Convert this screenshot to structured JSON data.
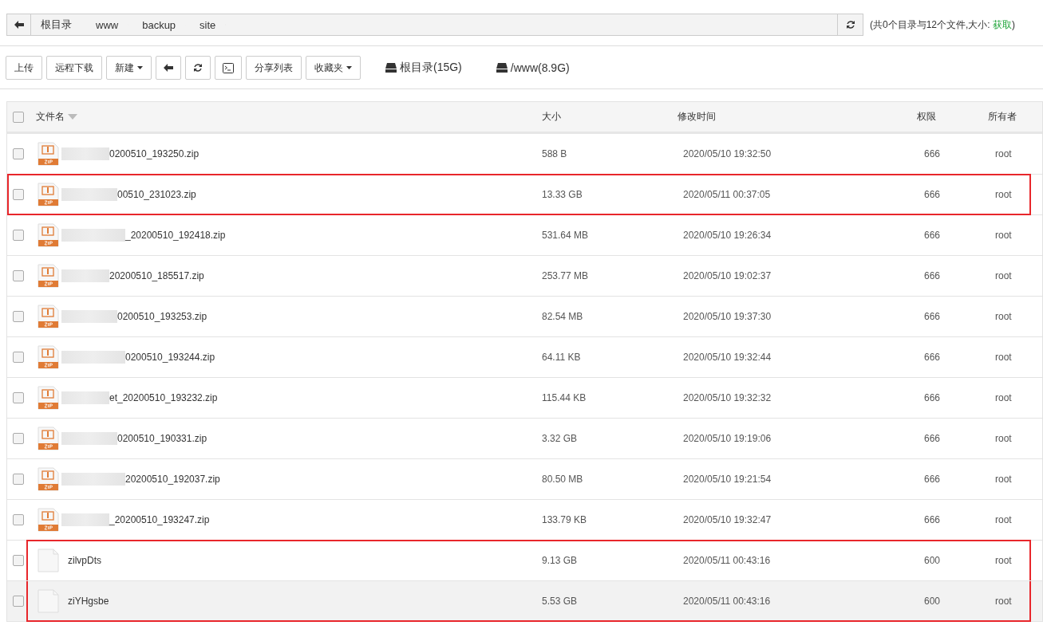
{
  "breadcrumb": [
    "根目录",
    "www",
    "backup",
    "site"
  ],
  "summary": {
    "text": "(共0个目录与12个文件,大小: ",
    "link": "获取",
    "close": ")"
  },
  "toolbar": [
    {
      "kind": "text",
      "label": "上传"
    },
    {
      "kind": "text",
      "label": "远程下载"
    },
    {
      "kind": "dropdown",
      "label": "新建"
    },
    {
      "kind": "back"
    },
    {
      "kind": "refresh"
    },
    {
      "kind": "terminal"
    },
    {
      "kind": "text",
      "label": "分享列表"
    },
    {
      "kind": "dropdown",
      "label": "收藏夹"
    }
  ],
  "disks": [
    "根目录(15G)",
    "/www(8.9G)"
  ],
  "columns": [
    "文件名",
    "大小",
    "修改时间",
    "权限",
    "所有者"
  ],
  "all_checked": false,
  "rows": [
    {
      "kind": "zip",
      "redacted": true,
      "name": "0200510_193250.zip",
      "size": "588 B",
      "modified": "2020/05/10 19:32:50",
      "perms": "666",
      "owner": "root",
      "checked": false,
      "highlighted": false,
      "hovered": false
    },
    {
      "kind": "zip",
      "redacted": true,
      "name": "00510_231023.zip",
      "size": "13.33 GB",
      "modified": "2020/05/11 00:37:05",
      "perms": "666",
      "owner": "root",
      "checked": false,
      "highlighted": true,
      "hovered": false
    },
    {
      "kind": "zip",
      "redacted": true,
      "name": "_20200510_192418.zip",
      "size": "531.64 MB",
      "modified": "2020/05/10 19:26:34",
      "perms": "666",
      "owner": "root",
      "checked": false,
      "highlighted": false,
      "hovered": false
    },
    {
      "kind": "zip",
      "redacted": true,
      "name": "20200510_185517.zip",
      "size": "253.77 MB",
      "modified": "2020/05/10 19:02:37",
      "perms": "666",
      "owner": "root",
      "checked": false,
      "highlighted": false,
      "hovered": false
    },
    {
      "kind": "zip",
      "redacted": true,
      "name": "0200510_193253.zip",
      "size": "82.54 MB",
      "modified": "2020/05/10 19:37:30",
      "perms": "666",
      "owner": "root",
      "checked": false,
      "highlighted": false,
      "hovered": false
    },
    {
      "kind": "zip",
      "redacted": true,
      "name": "0200510_193244.zip",
      "size": "64.11 KB",
      "modified": "2020/05/10 19:32:44",
      "perms": "666",
      "owner": "root",
      "checked": false,
      "highlighted": false,
      "hovered": false
    },
    {
      "kind": "zip",
      "redacted": true,
      "name": "et_20200510_193232.zip",
      "size": "115.44 KB",
      "modified": "2020/05/10 19:32:32",
      "perms": "666",
      "owner": "root",
      "checked": false,
      "highlighted": false,
      "hovered": false
    },
    {
      "kind": "zip",
      "redacted": true,
      "name": "0200510_190331.zip",
      "size": "3.32 GB",
      "modified": "2020/05/10 19:19:06",
      "perms": "666",
      "owner": "root",
      "checked": false,
      "highlighted": false,
      "hovered": false
    },
    {
      "kind": "zip",
      "redacted": true,
      "name": "20200510_192037.zip",
      "size": "80.50 MB",
      "modified": "2020/05/10 19:21:54",
      "perms": "666",
      "owner": "root",
      "checked": false,
      "highlighted": false,
      "hovered": false
    },
    {
      "kind": "zip",
      "redacted": true,
      "name": "_20200510_193247.zip",
      "size": "133.79 KB",
      "modified": "2020/05/10 19:32:47",
      "perms": "666",
      "owner": "root",
      "checked": false,
      "highlighted": false,
      "hovered": false
    },
    {
      "kind": "file",
      "redacted": false,
      "name": "zilvpDts",
      "size": "9.13 GB",
      "modified": "2020/05/11 00:43:16",
      "perms": "600",
      "owner": "root",
      "checked": false,
      "highlighted": true,
      "hovered": false
    },
    {
      "kind": "file",
      "redacted": false,
      "name": "ziYHgsbe",
      "size": "5.53 GB",
      "modified": "2020/05/11 00:43:16",
      "perms": "600",
      "owner": "root",
      "checked": false,
      "highlighted": true,
      "hovered": true
    }
  ]
}
